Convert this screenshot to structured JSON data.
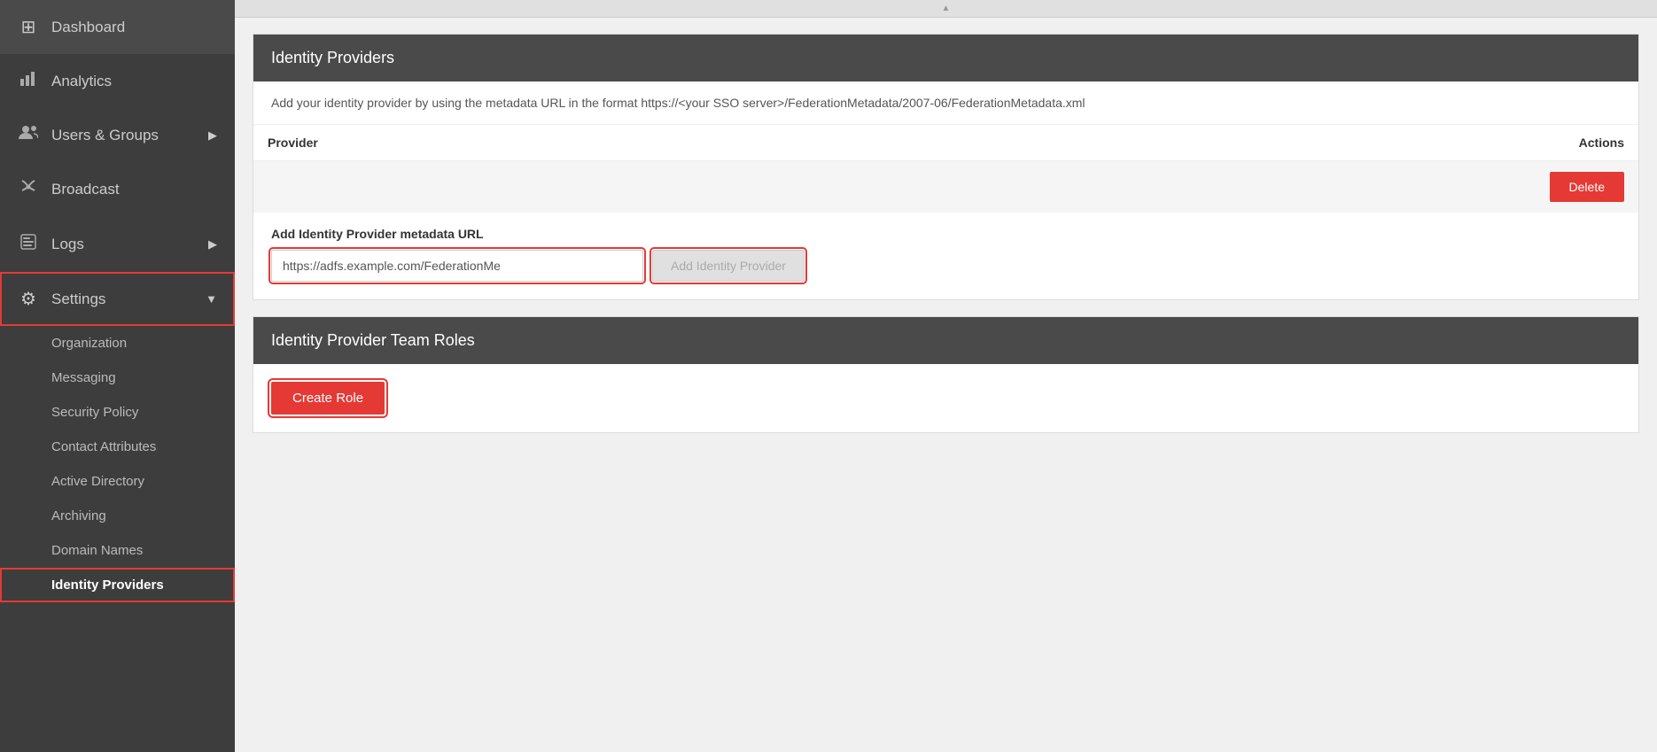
{
  "sidebar": {
    "items": [
      {
        "id": "dashboard",
        "label": "Dashboard",
        "icon": "⊞",
        "hasChevron": false
      },
      {
        "id": "analytics",
        "label": "Analytics",
        "icon": "📊",
        "hasChevron": false
      },
      {
        "id": "users-groups",
        "label": "Users & Groups",
        "icon": "👥",
        "hasChevron": true
      },
      {
        "id": "broadcast",
        "label": "Broadcast",
        "icon": "📢",
        "hasChevron": false
      },
      {
        "id": "logs",
        "label": "Logs",
        "icon": "🗄",
        "hasChevron": true
      },
      {
        "id": "settings",
        "label": "Settings",
        "icon": "⚙",
        "hasChevron": true,
        "isActive": true
      }
    ],
    "submenu": [
      {
        "id": "organization",
        "label": "Organization"
      },
      {
        "id": "messaging",
        "label": "Messaging"
      },
      {
        "id": "security-policy",
        "label": "Security Policy"
      },
      {
        "id": "contact-attributes",
        "label": "Contact Attributes"
      },
      {
        "id": "active-directory",
        "label": "Active Directory"
      },
      {
        "id": "archiving",
        "label": "Archiving"
      },
      {
        "id": "domain-names",
        "label": "Domain Names"
      },
      {
        "id": "identity-providers",
        "label": "Identity Providers",
        "isActive": true
      }
    ]
  },
  "main": {
    "identity_providers": {
      "section_title": "Identity Providers",
      "description": "Add your identity provider by using the metadata URL in the format https://<your SSO server>/FederationMetadata/2007-06/FederationMetadata.xml",
      "table": {
        "columns": [
          {
            "id": "provider",
            "label": "Provider"
          },
          {
            "id": "actions",
            "label": "Actions"
          }
        ],
        "rows": [
          {
            "provider": "",
            "delete_label": "Delete"
          }
        ]
      },
      "add_form": {
        "label": "Add Identity Provider metadata URL",
        "input_value": "https://adfs.example.com/FederationMe",
        "input_placeholder": "https://adfs.example.com/FederationMe",
        "button_label": "Add Identity Provider"
      }
    },
    "team_roles": {
      "section_title": "Identity Provider Team Roles",
      "create_role_label": "Create Role"
    }
  }
}
